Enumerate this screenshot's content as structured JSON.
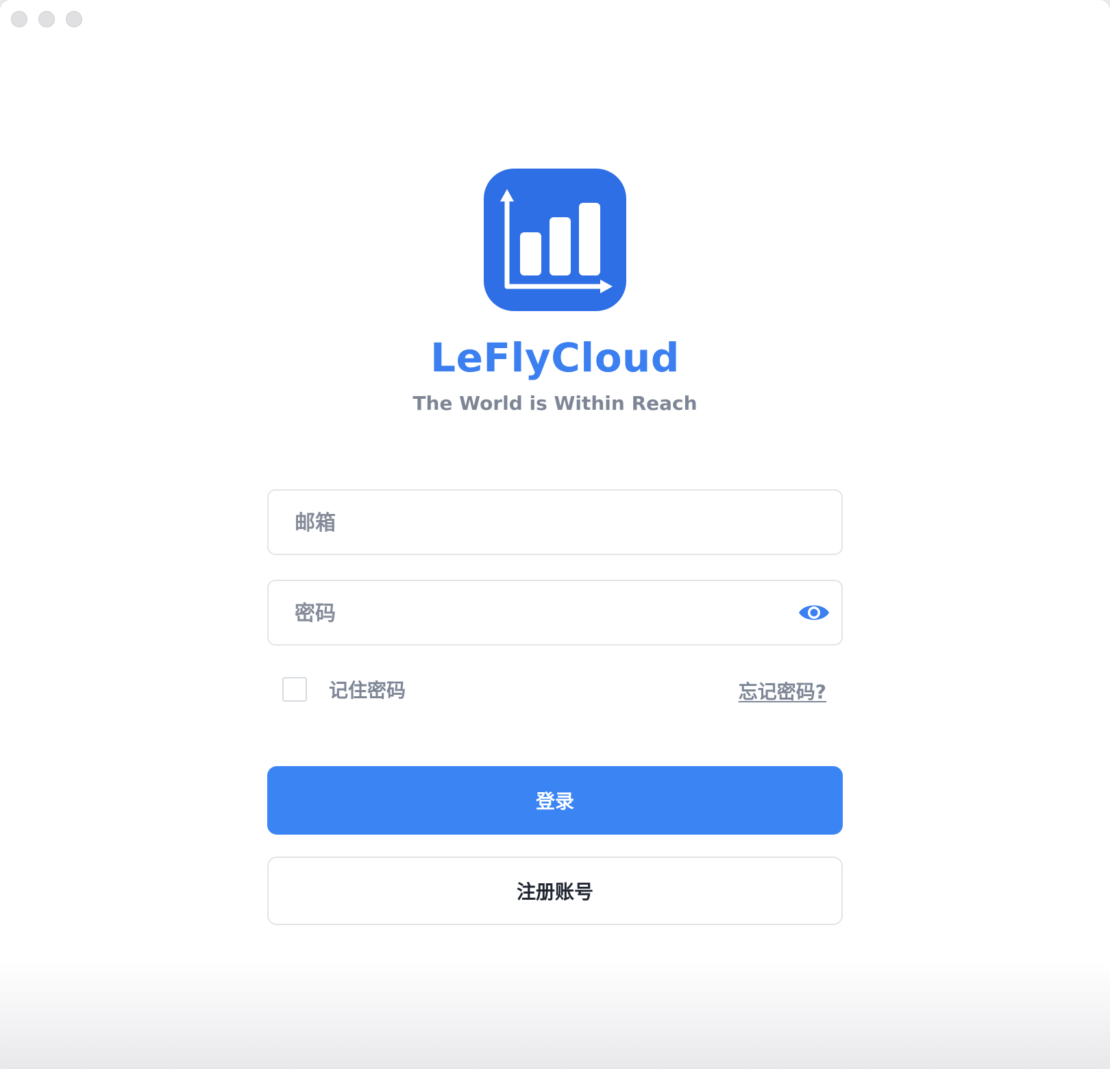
{
  "window": {
    "controls": [
      "close",
      "minimize",
      "zoom"
    ]
  },
  "brand": {
    "name": "LeFlyCloud",
    "tagline": "The World is Within Reach",
    "logo_icon": "bar-chart-icon",
    "accent_color": "#3b7ff0",
    "logo_bg_color": "#2f6fe6"
  },
  "form": {
    "email": {
      "placeholder": "邮箱",
      "value": ""
    },
    "password": {
      "placeholder": "密码",
      "value": "",
      "toggle_icon": "eye-icon"
    },
    "remember": {
      "label": "记住密码",
      "checked": false
    },
    "forgot_label": "忘记密码?",
    "login_label": "登录",
    "register_label": "注册账号"
  }
}
